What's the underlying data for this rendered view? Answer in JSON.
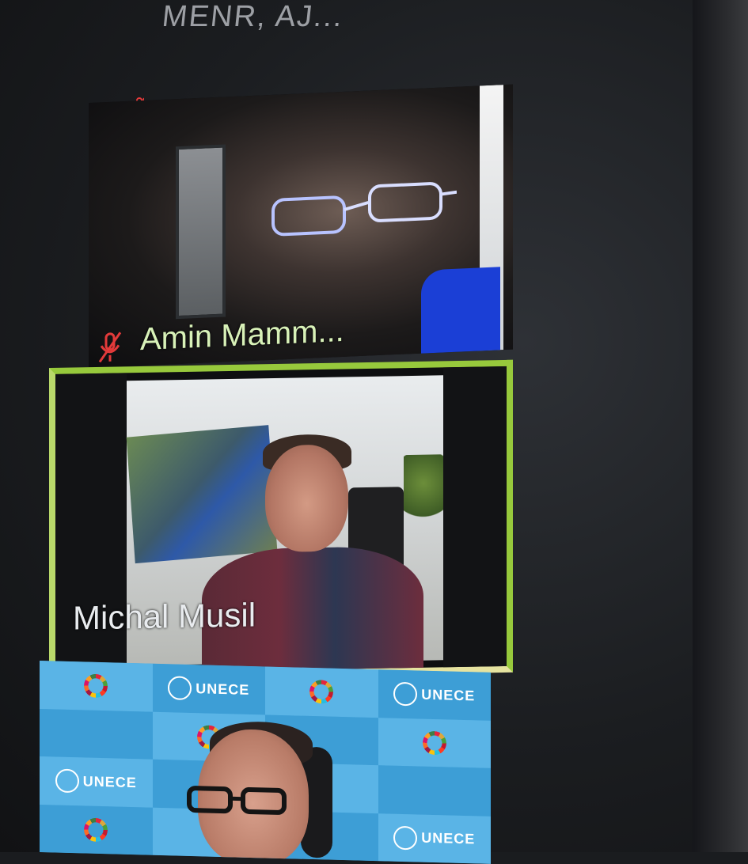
{
  "header": {
    "caption": "MENR, AJ..."
  },
  "participants": [
    {
      "name": "Amin Mamm...",
      "muted": true,
      "active_speaker": false
    },
    {
      "name": "Michal Musil",
      "muted": false,
      "active_speaker": true
    },
    {
      "name": "",
      "muted": false,
      "active_speaker": false
    }
  ],
  "backdrop": {
    "brand_text": "UNECE"
  },
  "colors": {
    "active_speaker_border": "#97c93c",
    "muted_mic": "#e23a3a",
    "background": "#1b1d20"
  },
  "icons": {
    "muted_mic": "mic-off-icon",
    "sdg_wheel": "sdg-wheel-icon",
    "un_logo": "un-emblem-icon"
  }
}
